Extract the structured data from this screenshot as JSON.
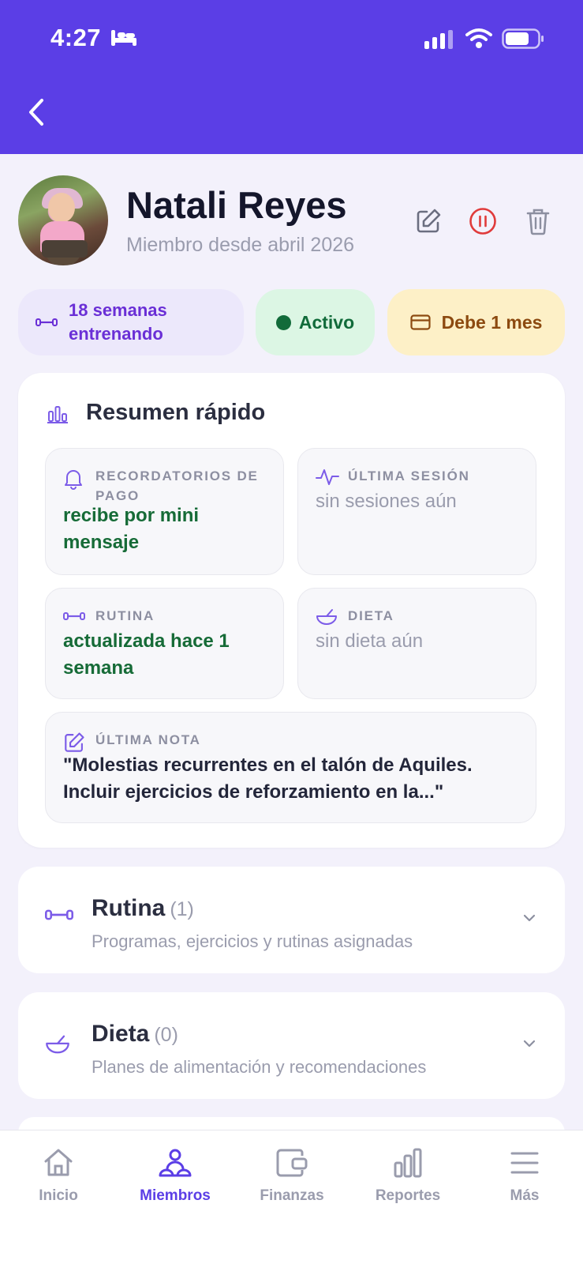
{
  "status": {
    "time": "4:27"
  },
  "profile": {
    "name": "Natali Reyes",
    "since": "Miembro desde abril 2026"
  },
  "chips": {
    "weeks": "18 semanas entrenando",
    "status": "Activo",
    "debt": "Debe 1 mes"
  },
  "summary": {
    "title": "Resumen rápido",
    "tiles": [
      {
        "label": "RECORDATORIOS DE PAGO",
        "value": "recibe por mini mensaje",
        "icon": "bell-icon"
      },
      {
        "label": "ÚLTIMA SESIÓN",
        "value": "sin sesiones aún",
        "icon": "activity-icon"
      },
      {
        "label": "RUTINA",
        "value": "actualizada hace 1 semana",
        "icon": "dumbbell-icon"
      },
      {
        "label": "DIETA",
        "value": "sin dieta aún",
        "icon": "bowl-icon"
      },
      {
        "label": "ÚLTIMA NOTA",
        "value": "\"Molestias recurrentes en el talón de Aquiles. Incluir ejercicios de reforzamiento en la...\"",
        "icon": "note-icon"
      }
    ]
  },
  "sections": [
    {
      "title": "Rutina",
      "count": "(1)",
      "subtitle": "Programas, ejercicios y rutinas asignadas"
    },
    {
      "title": "Dieta",
      "count": "(0)",
      "subtitle": "Planes de alimentación y recomendaciones"
    }
  ],
  "nav": [
    {
      "label": "Inicio",
      "icon": "home-icon"
    },
    {
      "label": "Miembros",
      "icon": "members-icon",
      "active": true
    },
    {
      "label": "Finanzas",
      "icon": "wallet-icon"
    },
    {
      "label": "Reportes",
      "icon": "chart-icon"
    },
    {
      "label": "Más",
      "icon": "menu-icon"
    }
  ],
  "colors": {
    "brand": "#5b3ee6",
    "active_green": "#126b3a",
    "debt_brown": "#8c4a10",
    "danger_red": "#e03b3b"
  }
}
